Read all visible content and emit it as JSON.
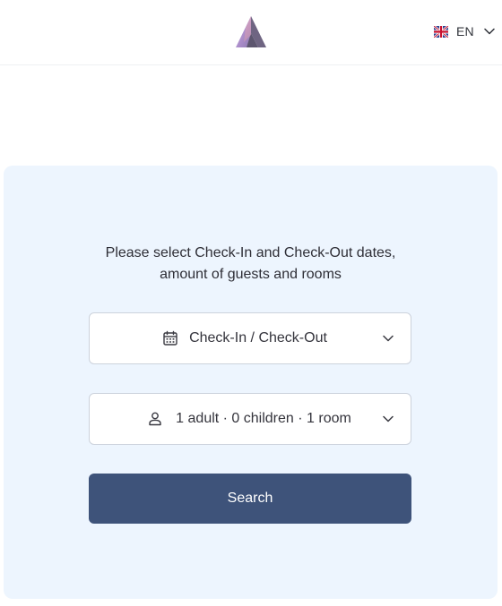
{
  "header": {
    "logo_icon": "mountain-logo",
    "language": {
      "flag_icon": "uk-flag-icon",
      "code": "EN",
      "chevron_icon": "chevron-down-icon"
    }
  },
  "booking": {
    "instructions_line1": "Please select Check-In and Check-Out dates,",
    "instructions_line2": "amount of guests and rooms",
    "dates": {
      "icon": "calendar-icon",
      "label": "Check-In / Check-Out",
      "chevron_icon": "chevron-down-icon"
    },
    "guests": {
      "icon": "person-icon",
      "label": "1 adult · 0 children · 1 room",
      "chevron_icon": "chevron-down-icon"
    },
    "search_label": "Search"
  },
  "colors": {
    "panel_background": "#edf5fe",
    "button_background": "#3e537a",
    "button_text": "#ffffff",
    "field_border": "#ccd2dc"
  }
}
